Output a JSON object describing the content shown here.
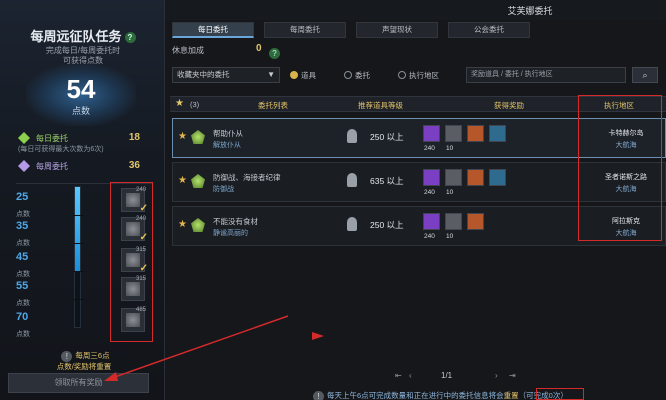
{
  "left_panel": {
    "title": "每周远征队任务",
    "desc_line1": "完成每日/每周委托时",
    "desc_line2": "可获得点数",
    "points": "54",
    "points_unit": "点数",
    "daily_label": "每日委托",
    "daily_value": "18",
    "daily_note": "(每日可获得最大次数为6次)",
    "weekly_label": "每周委托",
    "weekly_value": "36",
    "progress_fraction": 0.6,
    "tiers": [
      {
        "value": "25",
        "unit": "点数",
        "qty": "240",
        "claimed": true
      },
      {
        "value": "35",
        "unit": "点数",
        "qty": "240",
        "claimed": true
      },
      {
        "value": "45",
        "unit": "点数",
        "qty": "315",
        "claimed": true
      },
      {
        "value": "55",
        "unit": "点数",
        "qty": "315",
        "claimed": false
      },
      {
        "value": "70",
        "unit": "点数",
        "qty": "485",
        "claimed": false
      }
    ],
    "notice_line1": "每周三6点",
    "notice_line2": "点数/奖励将重置",
    "claim_all_button": "领取所有奖励"
  },
  "header": {
    "title": "艾芙娜委托"
  },
  "tabs": [
    {
      "label": "每日委托",
      "active": true
    },
    {
      "label": "每周委托",
      "active": false
    },
    {
      "label": "声望现状",
      "active": false
    },
    {
      "label": "公会委托",
      "active": false
    }
  ],
  "bonus": {
    "label": "休息加成",
    "value": "0"
  },
  "filter": {
    "dropdown_value": "收藏夹中的委托",
    "radios": [
      {
        "label": "道具",
        "selected": true
      },
      {
        "label": "委托",
        "selected": false
      },
      {
        "label": "执行地区",
        "selected": false
      }
    ],
    "search_placeholder": "奖励道具 / 委托 / 执行地区"
  },
  "table": {
    "fav_count": "(3)",
    "headers": [
      "委托列表",
      "推荐道具等级",
      "获得奖励",
      "执行地区"
    ],
    "rows": [
      {
        "name": "帮助仆从",
        "sub": "解放仆从",
        "level": "250 以上",
        "rewards": [
          {
            "qty": "240",
            "color": "#7b3fc4"
          },
          {
            "qty": "10",
            "color": "#5a5d63"
          },
          {
            "qty": "",
            "color": "#b5572a"
          },
          {
            "qty": "",
            "color": "#2f6a8f"
          }
        ],
        "area": "卡特赫尔岛",
        "region": "大航海"
      },
      {
        "name": "防御战、海接者纪律",
        "sub": "防御战",
        "level": "635 以上",
        "rewards": [
          {
            "qty": "240",
            "color": "#7b3fc4"
          },
          {
            "qty": "10",
            "color": "#5a5d63"
          },
          {
            "qty": "",
            "color": "#b5572a"
          },
          {
            "qty": "",
            "color": "#2f6a8f"
          }
        ],
        "area": "圣者诺斯之路",
        "region": "大航海"
      },
      {
        "name": "不能没有食材",
        "sub": "静谧高丽的",
        "level": "250 以上",
        "rewards": [
          {
            "qty": "240",
            "color": "#7b3fc4"
          },
          {
            "qty": "10",
            "color": "#5a5d63"
          },
          {
            "qty": "",
            "color": "#b5572a"
          }
        ],
        "area": "阿拉斯克",
        "region": "大航海"
      }
    ]
  },
  "pager": {
    "text": "1/1"
  },
  "footer": {
    "prefix": "每天上午6点可完成数量和正在进行中的委托信息将会",
    "reset_word": "重置",
    "suffix": "（可完成0次）"
  },
  "colors": {
    "accent_gold": "#e2c46b",
    "accent_blue": "#4fa7e8",
    "annotation_red": "#d42a2a"
  }
}
